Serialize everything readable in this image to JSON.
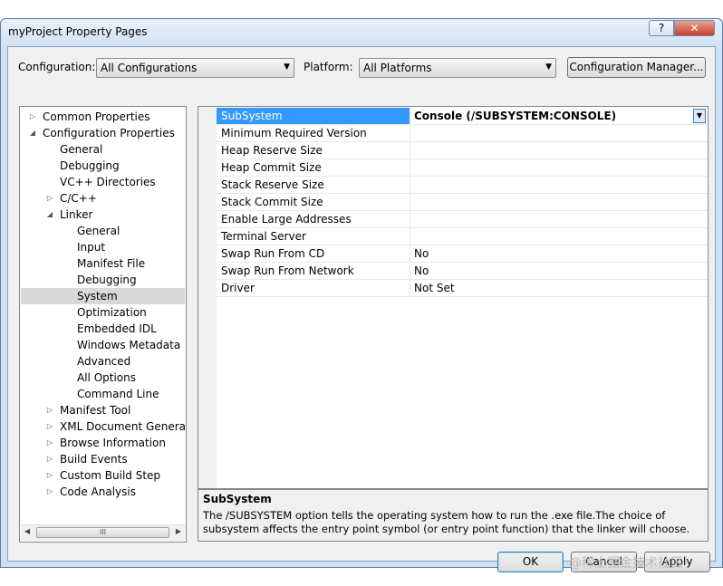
{
  "window": {
    "title": "myProject Property Pages",
    "help_label": "?",
    "close_label": "✕"
  },
  "toolbar": {
    "configuration_label": "Configuration:",
    "configuration_value": "All Configurations",
    "platform_label": "Platform:",
    "platform_value": "All Platforms",
    "config_manager_label": "Configuration Manager..."
  },
  "tree": {
    "items": [
      {
        "label": "Common Properties",
        "depth": 0,
        "expander": "collapsed"
      },
      {
        "label": "Configuration Properties",
        "depth": 0,
        "expander": "expanded"
      },
      {
        "label": "General",
        "depth": 1,
        "expander": "none"
      },
      {
        "label": "Debugging",
        "depth": 1,
        "expander": "none"
      },
      {
        "label": "VC++ Directories",
        "depth": 1,
        "expander": "none"
      },
      {
        "label": "C/C++",
        "depth": 1,
        "expander": "collapsed"
      },
      {
        "label": "Linker",
        "depth": 1,
        "expander": "expanded"
      },
      {
        "label": "General",
        "depth": 2,
        "expander": "none"
      },
      {
        "label": "Input",
        "depth": 2,
        "expander": "none"
      },
      {
        "label": "Manifest File",
        "depth": 2,
        "expander": "none"
      },
      {
        "label": "Debugging",
        "depth": 2,
        "expander": "none"
      },
      {
        "label": "System",
        "depth": 2,
        "expander": "none",
        "selected": true
      },
      {
        "label": "Optimization",
        "depth": 2,
        "expander": "none"
      },
      {
        "label": "Embedded IDL",
        "depth": 2,
        "expander": "none"
      },
      {
        "label": "Windows Metadata",
        "depth": 2,
        "expander": "none"
      },
      {
        "label": "Advanced",
        "depth": 2,
        "expander": "none"
      },
      {
        "label": "All Options",
        "depth": 2,
        "expander": "none"
      },
      {
        "label": "Command Line",
        "depth": 2,
        "expander": "none"
      },
      {
        "label": "Manifest Tool",
        "depth": 1,
        "expander": "collapsed"
      },
      {
        "label": "XML Document Generator",
        "depth": 1,
        "expander": "collapsed"
      },
      {
        "label": "Browse Information",
        "depth": 1,
        "expander": "collapsed"
      },
      {
        "label": "Build Events",
        "depth": 1,
        "expander": "collapsed"
      },
      {
        "label": "Custom Build Step",
        "depth": 1,
        "expander": "collapsed"
      },
      {
        "label": "Code Analysis",
        "depth": 1,
        "expander": "collapsed"
      }
    ],
    "scroll_grip": "III"
  },
  "properties": {
    "rows": [
      {
        "name": "SubSystem",
        "value": "Console (/SUBSYSTEM:CONSOLE)",
        "selected": true
      },
      {
        "name": "Minimum Required Version",
        "value": ""
      },
      {
        "name": "Heap Reserve Size",
        "value": ""
      },
      {
        "name": "Heap Commit Size",
        "value": ""
      },
      {
        "name": "Stack Reserve Size",
        "value": ""
      },
      {
        "name": "Stack Commit Size",
        "value": ""
      },
      {
        "name": "Enable Large Addresses",
        "value": ""
      },
      {
        "name": "Terminal Server",
        "value": ""
      },
      {
        "name": "Swap Run From CD",
        "value": "No"
      },
      {
        "name": "Swap Run From Network",
        "value": "No"
      },
      {
        "name": "Driver",
        "value": "Not Set"
      }
    ]
  },
  "description": {
    "title": "SubSystem",
    "text": "The /SUBSYSTEM option tells the operating system how to run the .exe file.The choice of subsystem affects the entry point symbol (or entry point function) that the linker will choose."
  },
  "buttons": {
    "ok": "OK",
    "cancel": "Cancel",
    "apply": "Apply"
  },
  "watermark": "@稀土掘金技术社区"
}
